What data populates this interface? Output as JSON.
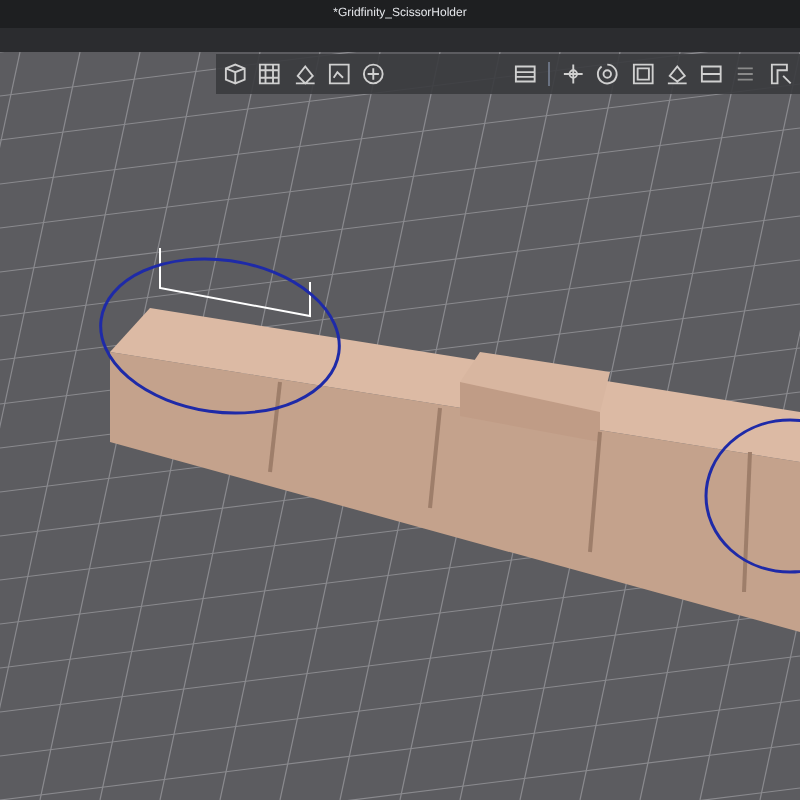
{
  "window": {
    "title": "*Gridfinity_ScissorHolder"
  }
}
